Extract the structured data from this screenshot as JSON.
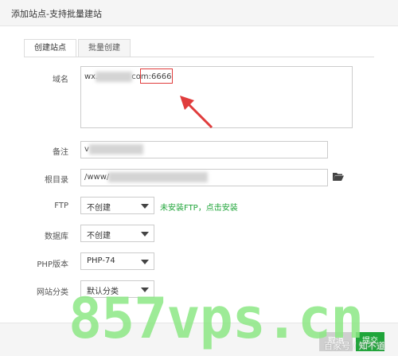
{
  "window": {
    "title": "添加站点-支持批量建站"
  },
  "tabs": [
    {
      "label": "创建站点",
      "active": true
    },
    {
      "label": "批量创建",
      "active": false
    }
  ],
  "form": {
    "domain": {
      "label": "域名",
      "value_prefix": "wx.",
      "value_mid": "com:",
      "value_port": "6666"
    },
    "remark": {
      "label": "备注",
      "value_prefix": "v"
    },
    "root": {
      "label": "根目录",
      "value_prefix": "/www/"
    },
    "ftp": {
      "label": "FTP",
      "selected": "不创建",
      "hint": "未安装FTP，点击安装"
    },
    "database": {
      "label": "数据库",
      "selected": "不创建"
    },
    "php": {
      "label": "PHP版本",
      "selected": "PHP-74"
    },
    "category": {
      "label": "网站分类",
      "selected": "默认分类"
    }
  },
  "buttons": {
    "cancel": "取消",
    "submit": "提交"
  },
  "overlays": {
    "watermark": "857vps.cn",
    "credit": "百家号 / 知不道"
  },
  "icons": {
    "folder": "folder-open-icon",
    "arrow": "red-arrow-annotation"
  },
  "colors": {
    "accent": "#20a53a",
    "annotation": "#e03c3c",
    "watermark": "#8de885"
  }
}
